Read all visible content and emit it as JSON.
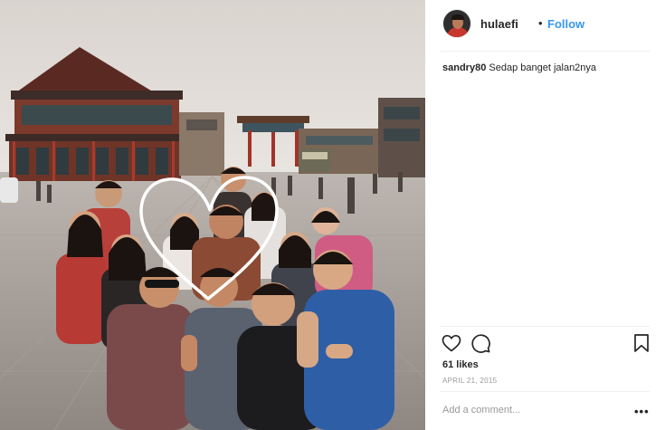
{
  "post": {
    "username": "hulaefi",
    "separator": "•",
    "follow_label": "Follow",
    "caption": {
      "user": "sandry80",
      "text": "Sedap banget jalan2nya"
    },
    "likes": "61 likes",
    "date": "APRIL 21, 2015",
    "comment_placeholder": "Add a comment...",
    "more_label": "•••"
  },
  "icons": {
    "like": "heart-icon",
    "comment": "comment-bubble-icon",
    "save": "bookmark-icon",
    "more": "ellipsis-icon"
  },
  "colors": {
    "link": "#3897f0",
    "text": "#262626",
    "muted": "#999999",
    "divider": "#efefef"
  }
}
